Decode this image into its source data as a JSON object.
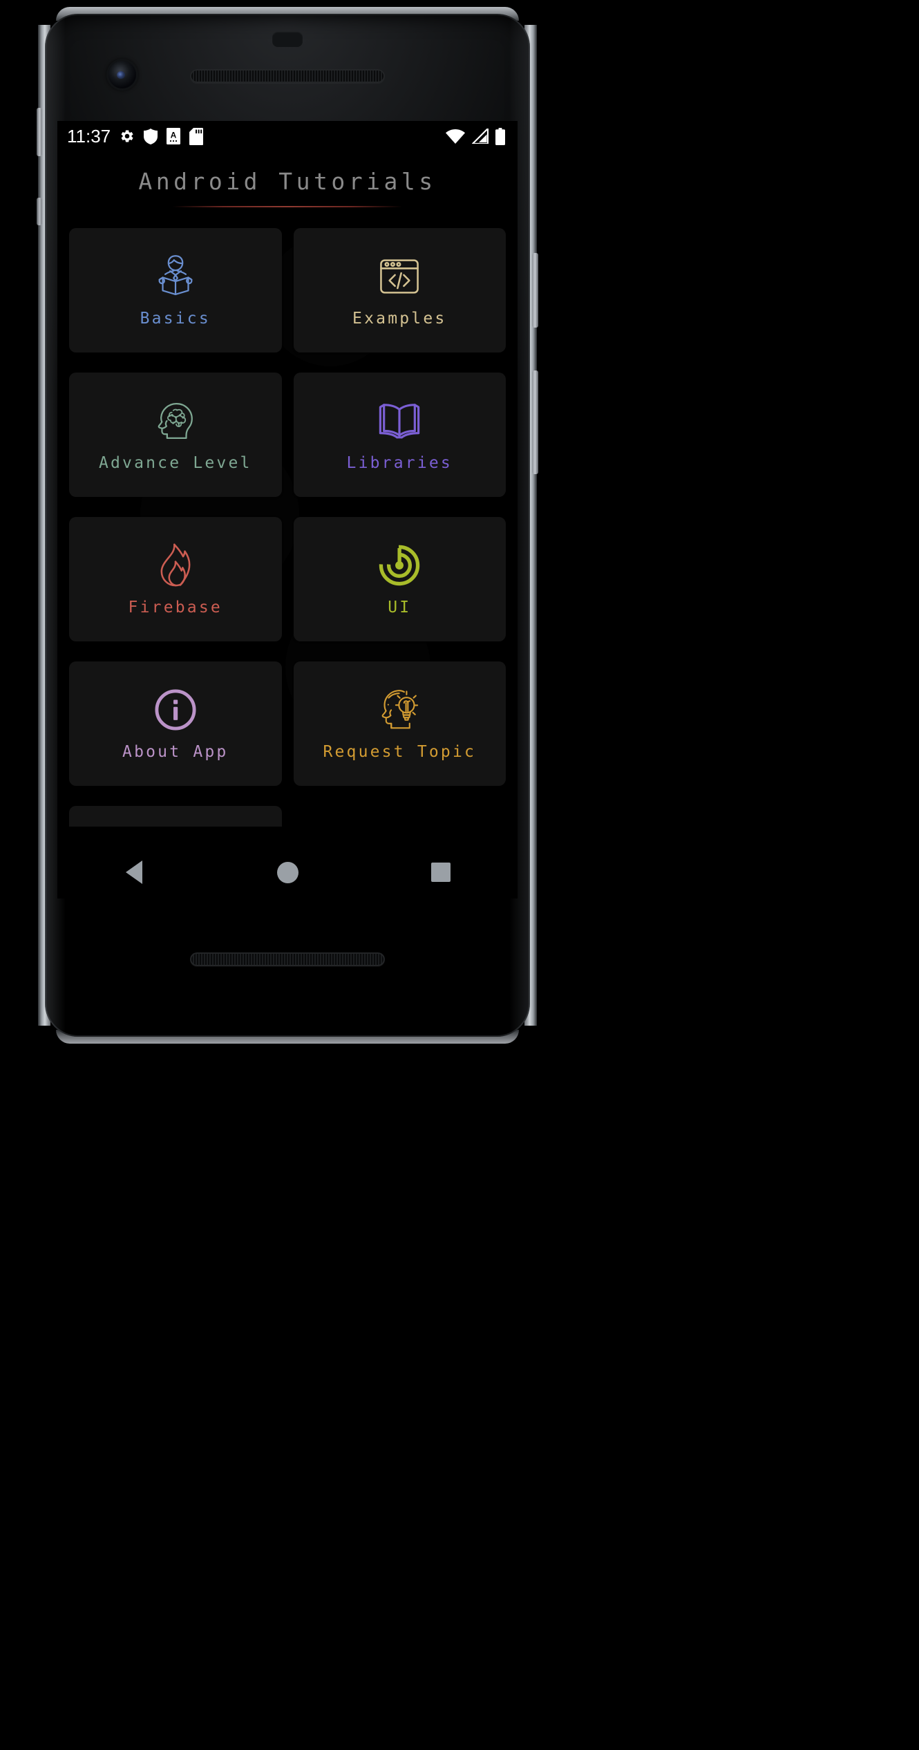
{
  "device": {
    "type": "android-phone",
    "frame_color": "#000000"
  },
  "status_bar": {
    "time": "11:37",
    "left_icons": [
      {
        "name": "gear-icon",
        "label": "settings"
      },
      {
        "name": "shield-icon",
        "label": "security"
      },
      {
        "name": "document-a-icon",
        "label": "document"
      },
      {
        "name": "sd-card-icon",
        "label": "sd-card"
      }
    ],
    "right_icons": [
      {
        "name": "wifi-icon",
        "label": "wifi"
      },
      {
        "name": "cellular-signal-icon",
        "label": "signal"
      },
      {
        "name": "battery-icon",
        "label": "battery"
      }
    ]
  },
  "app": {
    "title": "Android Tutorials",
    "title_color": "#8a8a8a",
    "divider_color": "#a8453a",
    "background": "#000000",
    "card_background": "#141414"
  },
  "grid": {
    "columns": 2,
    "items": [
      {
        "label": "Basics",
        "icon": "person-reading-book-icon",
        "color": "#6a8fd0"
      },
      {
        "label": "Examples",
        "icon": "code-window-icon",
        "color": "#d4c292"
      },
      {
        "label": "Advance Level",
        "icon": "brain-head-icon",
        "color": "#7fa893"
      },
      {
        "label": "Libraries",
        "icon": "open-book-icon",
        "color": "#7b5fd4"
      },
      {
        "label": "Firebase",
        "icon": "flame-icon",
        "color": "#cc5d52"
      },
      {
        "label": "UI",
        "icon": "radar-target-icon",
        "color": "#a8bc2a"
      },
      {
        "label": "About App",
        "icon": "info-circle-icon",
        "color": "#bb93c8"
      },
      {
        "label": "Request Topic",
        "icon": "head-lightbulb-icon",
        "color": "#d39c32"
      },
      {
        "label": "",
        "icon": "toolbox-icon",
        "color": "#9aa0a6"
      }
    ]
  },
  "nav_bar": {
    "buttons": [
      {
        "name": "back-button",
        "label": "Back"
      },
      {
        "name": "home-button",
        "label": "Home"
      },
      {
        "name": "recents-button",
        "label": "Recents"
      }
    ]
  }
}
